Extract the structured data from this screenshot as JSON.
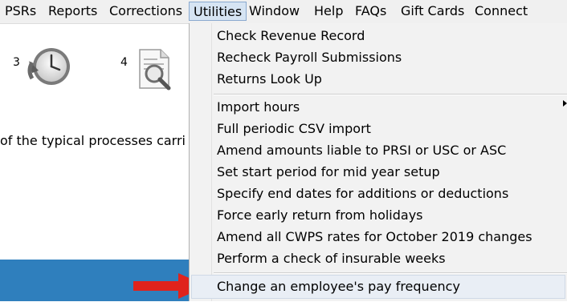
{
  "menubar": {
    "items": [
      {
        "label": "PSRs"
      },
      {
        "label": "Reports"
      },
      {
        "label": "Corrections"
      },
      {
        "label": "Utilities"
      },
      {
        "label": "Window"
      },
      {
        "label": "Help"
      },
      {
        "label": "FAQs"
      },
      {
        "label": "Gift Cards"
      },
      {
        "label": "Connect"
      }
    ],
    "active": "Utilities"
  },
  "background": {
    "step3_number": "3",
    "step3_icon": "clock-arrow-icon",
    "step4_number": "4",
    "step4_icon": "document-search-icon",
    "description": "of the typical processes carri"
  },
  "utilities_menu": {
    "group1": [
      {
        "label": "Check Revenue Record"
      },
      {
        "label": "Recheck Payroll Submissions"
      },
      {
        "label": "Returns Look Up"
      }
    ],
    "group2": [
      {
        "label": "Import hours",
        "has_submenu": true
      },
      {
        "label": "Full periodic CSV import"
      },
      {
        "label": "Amend amounts liable to PRSI or USC or ASC"
      },
      {
        "label": "Set start period for mid year setup"
      },
      {
        "label": "Specify end dates for additions or deductions"
      },
      {
        "label": "Force early return from holidays"
      },
      {
        "label": "Amend all CWPS rates for October 2019 changes"
      },
      {
        "label": "Perform a check of insurable weeks"
      }
    ],
    "group3": [
      {
        "label": "Change an employee's pay frequency",
        "highlighted": true
      }
    ]
  },
  "colors": {
    "accent_blue": "#2f7fbd",
    "arrow_red": "#e0231c",
    "menu_bg": "#f2f2f2"
  }
}
